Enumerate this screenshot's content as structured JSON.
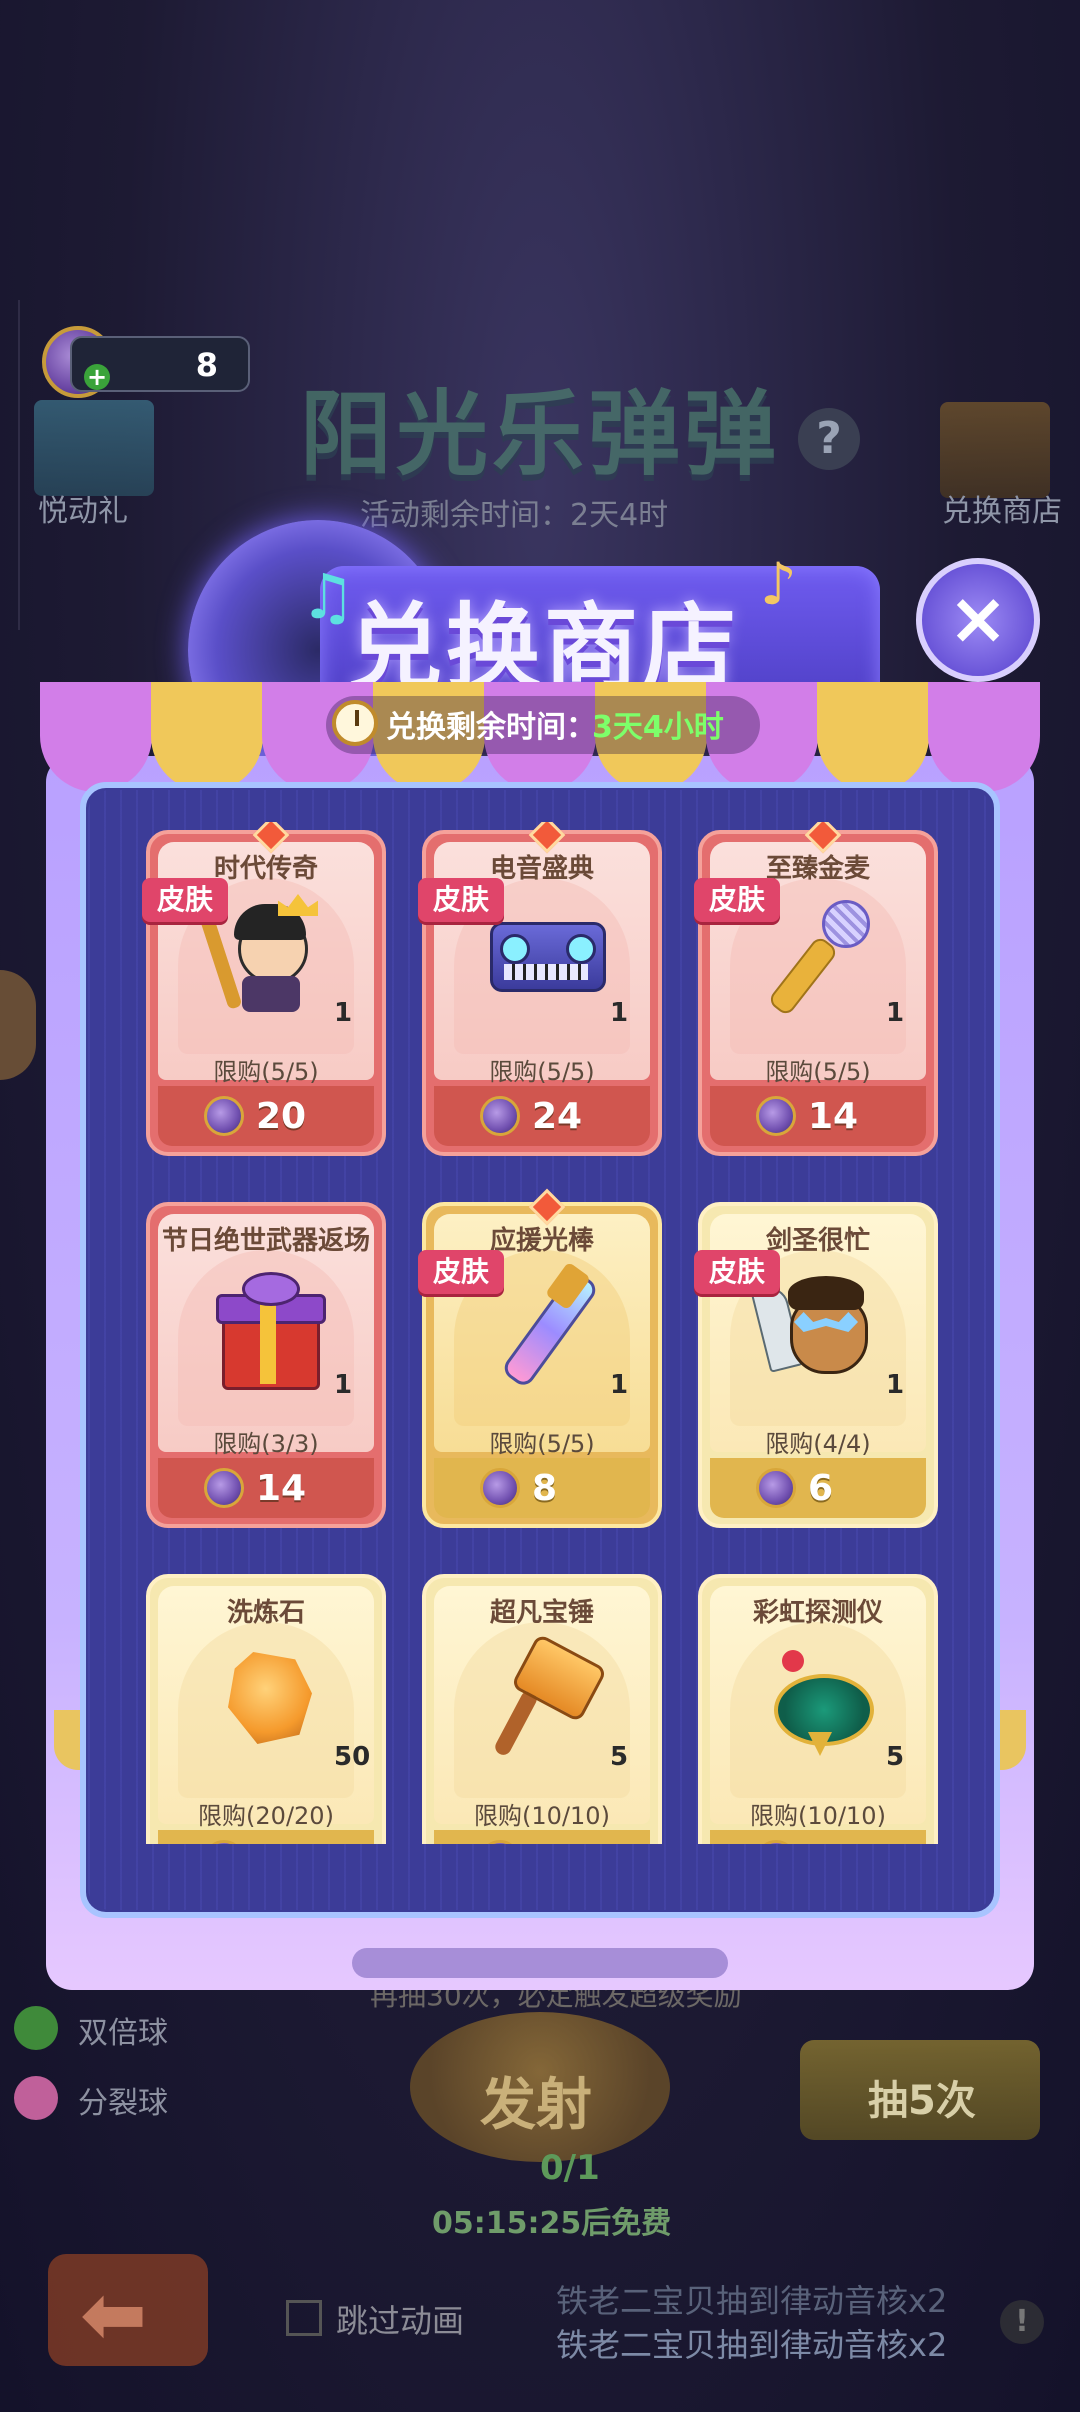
{
  "background": {
    "coins": "8",
    "event_title": "阳光乐弹弹",
    "help_icon": "?",
    "event_remaining": "活动剩余时间：2天4时",
    "left_button_label": "悦动礼",
    "right_button_label": "兑换商店",
    "banner_text": "再抽30次，必定触发超级奖励",
    "buffs": [
      {
        "label": "双倍球",
        "color": "#3f8a3a"
      },
      {
        "label": "分裂球",
        "color": "#c0609a"
      }
    ],
    "fire_button": "发射",
    "fire_count": "0/1",
    "free_timer": "05:15:25后免费",
    "draw_five": "抽5次",
    "back_icon": "back-arrow-icon",
    "skip_animation": "跳过动画",
    "ticker_top": "铁老二宝贝抽到律动音核x2",
    "ticker": "铁老二宝贝抽到律动音核x2",
    "warn_icon": "!"
  },
  "modal": {
    "title": "兑换商店",
    "close_icon": "×",
    "timer_label": "兑换剩余时间：",
    "timer_value": "3天4小时",
    "accent_timer_color": "#7dff6a",
    "items": [
      {
        "name": "时代传奇",
        "tag": "皮肤",
        "qty": "1",
        "limit": "限购(5/5)",
        "price": "20",
        "style": "red"
      },
      {
        "name": "电音盛典",
        "tag": "皮肤",
        "qty": "1",
        "limit": "限购(5/5)",
        "price": "24",
        "style": "red"
      },
      {
        "name": "至臻金麦",
        "tag": "皮肤",
        "qty": "1",
        "limit": "限购(5/5)",
        "price": "14",
        "style": "red"
      },
      {
        "name": "节日绝世武器返场",
        "tag": "",
        "qty": "1",
        "limit": "限购(3/3)",
        "price": "14",
        "style": "red"
      },
      {
        "name": "应援光棒",
        "tag": "皮肤",
        "qty": "1",
        "limit": "限购(5/5)",
        "price": "8",
        "style": "gold"
      },
      {
        "name": "剑圣很忙",
        "tag": "皮肤",
        "qty": "1",
        "limit": "限购(4/4)",
        "price": "6",
        "style": "cream"
      },
      {
        "name": "洗炼石",
        "tag": "",
        "qty": "50",
        "limit": "限购(20/20)",
        "price": "",
        "style": "cream"
      },
      {
        "name": "超凡宝锤",
        "tag": "",
        "qty": "5",
        "limit": "限购(10/10)",
        "price": "",
        "style": "cream"
      },
      {
        "name": "彩虹探测仪",
        "tag": "",
        "qty": "5",
        "limit": "限购(10/10)",
        "price": "",
        "style": "cream"
      }
    ]
  }
}
